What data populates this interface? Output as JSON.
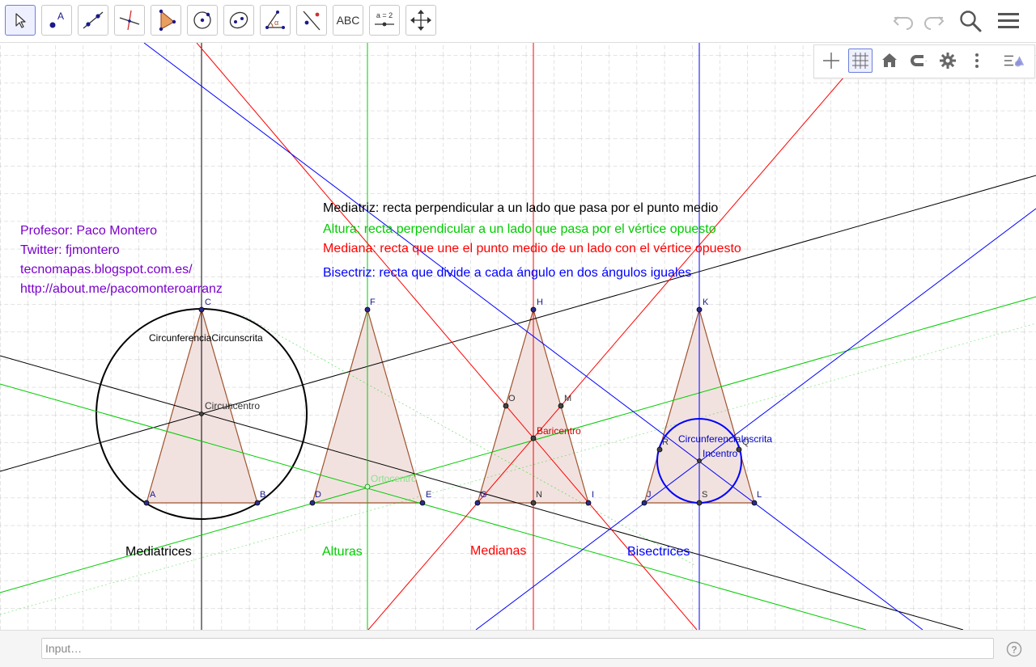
{
  "toolbar": {
    "tools": [
      {
        "name": "move-tool"
      },
      {
        "name": "point-tool",
        "label": "A"
      },
      {
        "name": "line-tool"
      },
      {
        "name": "perpendicular-line-tool"
      },
      {
        "name": "polygon-tool"
      },
      {
        "name": "circle-tool"
      },
      {
        "name": "conic-tool"
      },
      {
        "name": "angle-tool",
        "label": "α"
      },
      {
        "name": "reflect-tool"
      },
      {
        "name": "text-tool",
        "label": "ABC"
      },
      {
        "name": "slider-tool",
        "label": "a = 2"
      },
      {
        "name": "move-graphics-view-tool"
      }
    ],
    "undo_icon": "undo-icon",
    "redo_icon": "redo-icon",
    "search_icon": "search-icon",
    "menu_icon": "menu-icon"
  },
  "style_bar": {
    "buttons": [
      "axes-toggle",
      "grid-toggle",
      "home-view",
      "point-capturing",
      "settings",
      "more",
      "style-bar-toggle"
    ],
    "grid_on": true
  },
  "info": {
    "professor": "Profesor: Paco Montero",
    "twitter": "Twitter: fjmontero",
    "blog": "tecnomapas.blogspot.com.es/",
    "aboutme": "http://about.me/pacomonteroarranz"
  },
  "definitions": {
    "mediatriz": "Mediatriz: recta perpendicular a un lado que pasa por el punto medio",
    "altura": "Altura: recta perpendicular a un lado que pasa por el vértice opuesto",
    "mediana": "Mediana: recta que une el punto medio de un lado con el vértice opuesto",
    "bisectriz": "Bisectriz: recta que divide a cada ángulo en dos ángulos iguales"
  },
  "captions": {
    "mediatrices": "Mediatrices",
    "alturas": "Alturas",
    "medianas": "Medianas",
    "bisectrices": "Bisectrices"
  },
  "points": {
    "A": "A",
    "B": "B",
    "C": "C",
    "D": "D",
    "E": "E",
    "F": "F",
    "G": "G",
    "H": "H",
    "I": "I",
    "J": "J",
    "K": "K",
    "L": "L",
    "M": "M",
    "N": "N",
    "O": "O",
    "R": "R",
    "S": "S",
    "Q": "Q"
  },
  "centers": {
    "circuncentro": "Circuncentro",
    "circunferencia_circunscrita": "CircunferenciaCircunscrita",
    "ortocentro": "Ortocentro",
    "baricentro": "Baricentro",
    "incentro": "Incentro",
    "circunferencia_inscrita": "CircunferenciaInscrita"
  },
  "colors": {
    "mediatriz": "#000000",
    "altura": "#00cc00",
    "mediana": "#ff0000",
    "bisectriz": "#0000ff",
    "info": "#7a00cc",
    "triangle_fill": "#f0e0dc",
    "triangle_edge": "#a0522d"
  },
  "input": {
    "placeholder": "Input…",
    "help_icon": "help-icon"
  }
}
